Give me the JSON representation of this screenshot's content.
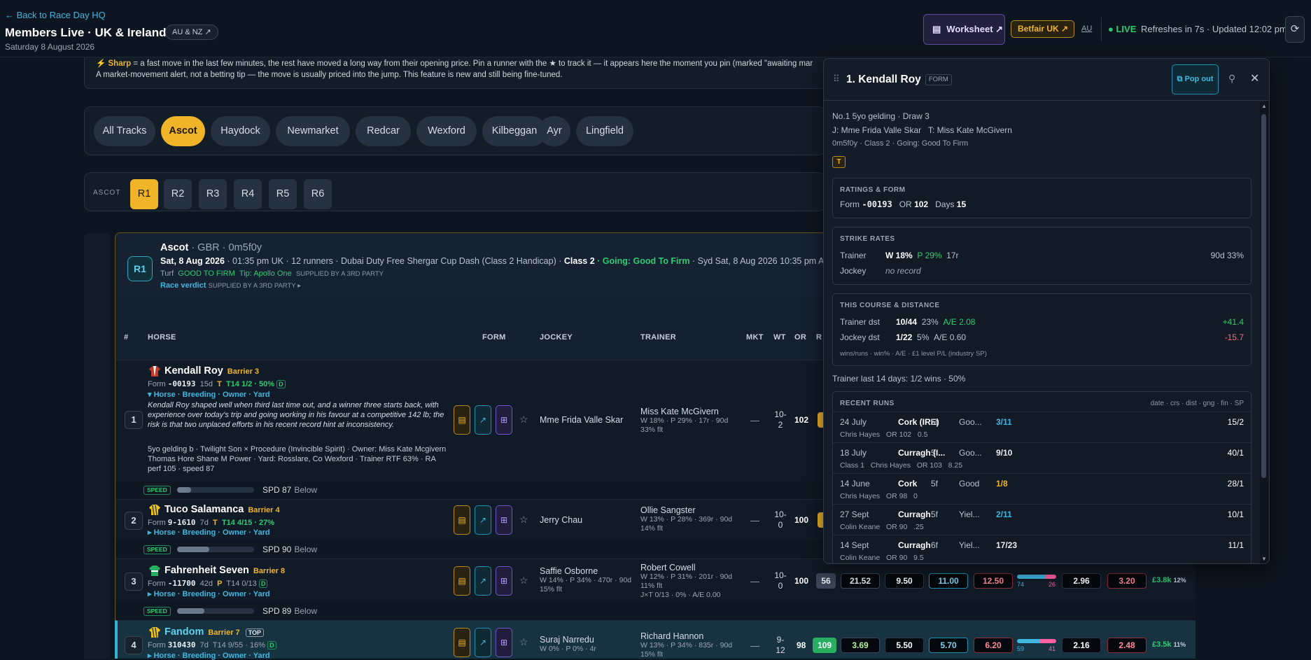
{
  "header": {
    "back": "← Back to Race Day HQ",
    "title": "Members Live · UK & Ireland",
    "region_pill": "AU & NZ ↗",
    "date": "Saturday 8 August 2026",
    "worksheet": "Worksheet ↗",
    "betfair": "Betfair UK ↗",
    "au": "AU",
    "live": "● LIVE",
    "refresh": "Refreshes in 7s · Updated 12:02 pm"
  },
  "banner": {
    "line1_tag": "⚡ Sharp",
    "line1": "= a fast move in the last few minutes, the rest have moved a long way from their opening price. Pin a runner with the ★ to track it — it appears here the moment you pin (marked \"awaiting mar",
    "line2": "A market-movement alert, not a betting tip — the move is usually priced into the jump. This feature is new and still being fine-tuned."
  },
  "tracks": [
    "All Tracks",
    "Ascot",
    "Haydock",
    "Newmarket",
    "Redcar",
    "Wexford",
    "Kilbeggan",
    "Ayr",
    "Lingfield"
  ],
  "active_track": "Ascot",
  "race_bar": {
    "label": "ASCOT",
    "races": [
      "R1",
      "R2",
      "R3",
      "R4",
      "R5",
      "R6"
    ],
    "active": "R1"
  },
  "race": {
    "badge": "R1",
    "venue": "Ascot",
    "venue_sub": " · GBR · 0m5f0y",
    "date_bold": "Sat, 8 Aug 2026",
    "details": " · 01:35 pm UK · 12 runners · Dubai Duty Free Shergar Cup Dash (Class 2 Handicap) · ",
    "class": "Class 2",
    "going": " · Going: Good To Firm",
    "syd": " · Syd Sat, 8 Aug 2026 10:35 pm AE",
    "surface": "Turf",
    "surface_going": "GOOD TO FIRM",
    "tip": "Tip: Apollo One",
    "supplied": "SUPPLIED BY A 3RD PARTY",
    "verdict": "Race verdict",
    "verdict_supplied": "SUPPLIED BY A 3RD PARTY ▸"
  },
  "columns": {
    "num": "#",
    "horse": "HORSE",
    "form": "FORM",
    "jockey": "JOCKEY",
    "trainer": "TRAINER",
    "mkt": "MKT",
    "wt": "WT",
    "or": "OR",
    "r": "R"
  },
  "runners": [
    {
      "num": "1",
      "name": "Kendall Roy",
      "barrier": "Barrier 3",
      "form_label": "Form",
      "form": "-00193",
      "days": "15d",
      "t": "T",
      "t14": "T14 1/2 · 50%",
      "d": "D",
      "links": "▾ Horse · Breeding · Owner · Yard",
      "comment": "Kendall Roy shaped well when third last time out, and a winner three starts back, with experience over today's trip and going working in his favour at a competitive 142 lb; the risk is that two unplaced efforts in his recent record hint at inconsistency.",
      "breeding": "5yo gelding b · Twilight Son × Procedure (Invincible Spirit) · Owner: Miss Kate Mcgivern Thomas Hore Shane M Power · Yard: Rosslare, Co Wexford · Trainer RTF 63% · RA perf 105 · speed 87",
      "jockey": "Mme Frida Valle Skar",
      "jockey_sub": "",
      "trainer": "Miss Kate McGivern",
      "trainer_sub1": "W 18% · P 29% · 17r · 90d",
      "trainer_sub2": "33% flt",
      "trainer_sub3": "",
      "mkt": "—",
      "wt1": "10-",
      "wt2": "2",
      "or": "102",
      "speed_label": "SPEED",
      "spd": "SPD 87",
      "spd_rank": "Below",
      "spd_fill": 0.18
    },
    {
      "num": "2",
      "name": "Tuco Salamanca",
      "barrier": "Barrier 4",
      "form_label": "Form",
      "form": "9-1610",
      "days": "7d",
      "t": "T",
      "t14": "T14 4/15 · 27%",
      "d": "",
      "links": "▸ Horse · Breeding · Owner · Yard",
      "jockey": "Jerry Chau",
      "jockey_sub": "",
      "trainer": "Ollie Sangster",
      "trainer_sub1": "W 13% · P 28% · 369r · 90d",
      "trainer_sub2": "14% flt",
      "trainer_sub3": "",
      "mkt": "—",
      "wt1": "10-",
      "wt2": "0",
      "or": "100",
      "speed_label": "SPEED",
      "spd": "SPD 90",
      "spd_rank": "Below",
      "spd_fill": 0.42
    },
    {
      "num": "3",
      "name": "Fahrenheit Seven",
      "barrier": "Barrier 8",
      "form_label": "Form",
      "form": "-11700",
      "days": "42d",
      "t": "P",
      "t14": "T14 0/13",
      "d": "D",
      "links": "▸ Horse · Breeding · Owner · Yard",
      "jockey": "Saffie Osborne",
      "jockey_sub": "W 14% · P 34% · 470r · 90d",
      "jockey_sub2": "15% flt",
      "trainer": "Robert Cowell",
      "trainer_sub1": "W 12% · P 31% · 201r · 90d",
      "trainer_sub2": "11% flt",
      "trainer_sub3": "J×T 0/13 · 0% · A/E 0.00",
      "mkt": "—",
      "wt1": "10-",
      "wt2": "0",
      "or": "100",
      "rating": "56",
      "o1": "21.52",
      "o2": "9.50",
      "o3": "11.00",
      "o4": "12.50",
      "back": "74",
      "lay": "26",
      "o5": "2.96",
      "o6": "3.20",
      "money": "£3.8k",
      "pct": "12%",
      "speed_label": "SPEED",
      "spd": "SPD 89",
      "spd_rank": "Below",
      "spd_fill": 0.35
    },
    {
      "num": "4",
      "name": "Fandom",
      "barrier": "Barrier 7",
      "top": "TOP",
      "form_label": "Form",
      "form": "310430",
      "days": "7d",
      "t": "",
      "t14": "T14 9/55 · 16%",
      "d": "D",
      "links": "▸ Horse · Breeding · Owner · Yard",
      "jockey": "Suraj Narredu",
      "jockey_sub": "W 0% · P 0% · 4r",
      "trainer": "Richard Hannon",
      "trainer_sub1": "W 13% · P 34% · 835r · 90d",
      "trainer_sub2": "15% flt",
      "trainer_sub3": "",
      "mkt": "—",
      "wt1": "9-",
      "wt2": "12",
      "or": "98",
      "rating": "109",
      "o1": "3.69",
      "o2": "5.50",
      "o3": "5.70",
      "o4": "6.20",
      "back": "59",
      "lay": "41",
      "o5": "2.16",
      "o6": "2.48",
      "money": "£3.5k",
      "pct": "11%"
    }
  ],
  "panel": {
    "title": "1. Kendall Roy",
    "form_tag": "FORM",
    "popout": "Pop out",
    "line1": "No.1 5yo gelding · Draw 3",
    "line2": "J: Mme Frida Valle Skar   T: Miss Kate McGivern",
    "line3": "0m5f0y · Class 2 · Going: Good To Firm",
    "t_badge": "T",
    "ratings_title": "RATINGS & FORM",
    "ratings": {
      "form_label": "Form",
      "form": "-00193",
      "or_label": "OR",
      "or": "102",
      "days_label": "Days",
      "days": "15"
    },
    "strike_title": "STRIKE RATES",
    "trainer_label": "Trainer",
    "trainer_w": "W 18%",
    "trainer_p": "P 29%",
    "trainer_r": "17r",
    "trainer_90d": "90d 33%",
    "jockey_label": "Jockey",
    "jockey_val": "no record",
    "cd_title": "THIS COURSE & DISTANCE",
    "trainer_dst_label": "Trainer dst",
    "trainer_dst": "10/44",
    "trainer_dst_pct": "23%",
    "trainer_dst_ae": "A/E 2.08",
    "trainer_dst_pl": "+41.4",
    "jockey_dst_label": "Jockey dst",
    "jockey_dst": "1/22",
    "jockey_dst_pct": "5%",
    "jockey_dst_ae": "A/E 0.60",
    "jockey_dst_pl": "-15.7",
    "cd_note": "wins/runs · win% · A/E · £1 level P/L (industry SP)",
    "trainer14": "Trainer last 14 days: 1/2 wins · 50%",
    "runs_title": "RECENT RUNS",
    "runs_legend": "date · crs · dist · gng · fin · SP",
    "runs": [
      {
        "date": "24 July",
        "course": "Cork (IRE)",
        "dist": "5f",
        "going": "Goo...",
        "fin": "3/11",
        "sp": "15/2",
        "sub": "Chris Hayes   OR 102   0.5",
        "fin_color": "#3fb6e0"
      },
      {
        "date": "18 July",
        "course": "Curragh (I...",
        "dist": "5f",
        "going": "Goo...",
        "fin": "9/10",
        "sp": "40/1",
        "sub": "Class 1   Chris Hayes   OR 103   8.25",
        "fin_color": "#e7edf3"
      },
      {
        "date": "14 June",
        "course": "Cork",
        "dist": "5f",
        "going": "Good",
        "fin": "1/8",
        "sp": "28/1",
        "sub": "Chris Hayes   OR 98   0",
        "fin_color": "#f0b429"
      },
      {
        "date": "27 Sept",
        "course": "Curragh",
        "dist": "5f",
        "going": "Yiel...",
        "fin": "2/11",
        "sp": "10/1",
        "sub": "Colin Keane   OR 90   .25",
        "fin_color": "#3fb6e0"
      },
      {
        "date": "14 Sept",
        "course": "Curragh",
        "dist": "6f",
        "going": "Yiel...",
        "fin": "17/23",
        "sp": "11/1",
        "sub": "Colin Keane   OR 90   9.5",
        "fin_color": "#e7edf3"
      }
    ]
  },
  "colors": {
    "accent": "#f0b429",
    "cyan": "#3fb6e0",
    "green": "#2ecc71",
    "bg": "#0d1520"
  }
}
